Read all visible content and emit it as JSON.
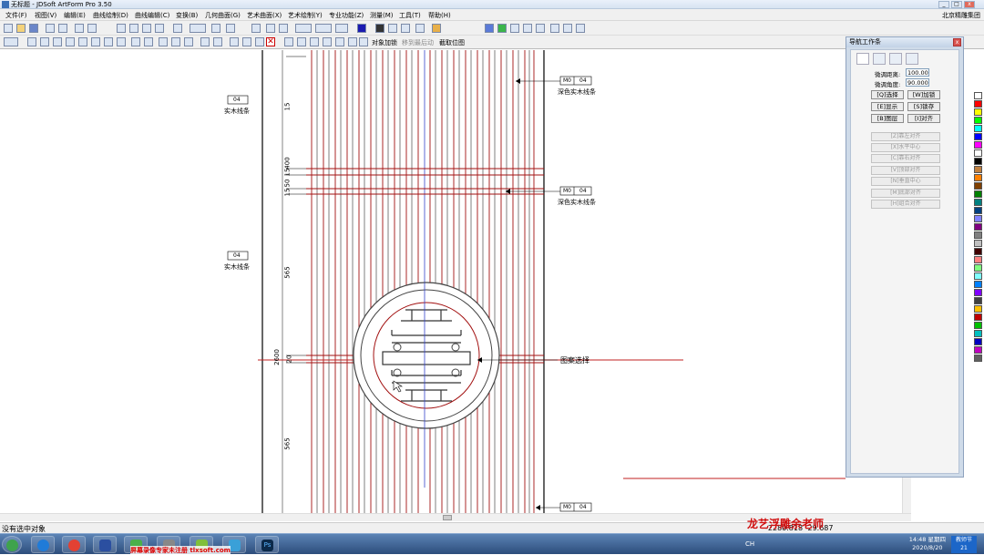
{
  "window": {
    "title": "无标题 - JDSoft ArtForm Pro 3.50",
    "company": "北京精雕集团"
  },
  "menu": [
    "文件(F)",
    "视图(V)",
    "编辑(E)",
    "曲线绘制(D)",
    "曲线编辑(C)",
    "变换(B)",
    "几何曲面(G)",
    "艺术曲面(X)",
    "艺术绘制(Y)",
    "专业功能(Z)",
    "测量(M)",
    "工具(T)",
    "帮助(H)"
  ],
  "toolbar2": {
    "object_add": "对象加锁",
    "move_follow": "移到最后动",
    "capture_bitmap": "截取位图"
  },
  "drawing": {
    "dims_left": [
      "15",
      "400",
      "15",
      "50",
      "15",
      "565",
      "2600",
      "20",
      "565"
    ],
    "left_tags": [
      {
        "code": "04",
        "label": "实木线条"
      },
      {
        "code": "04",
        "label": "实木线条"
      }
    ],
    "right_tags": [
      {
        "code_a": "M0",
        "code_b": "04",
        "label": "深色实木线条"
      },
      {
        "code_a": "M0",
        "code_b": "04",
        "label": "深色实木线条"
      },
      {
        "code_a": "M0",
        "code_b": "04",
        "label": ""
      }
    ],
    "pattern_label": "图案选择"
  },
  "panel": {
    "title": "导航工作条",
    "fine_distance_label": "微调距离:",
    "fine_distance_value": "100.00",
    "fine_angle_label": "微调角度:",
    "fine_angle_value": "90.000",
    "buttons": [
      "[Q]选择",
      "[W]加锁",
      "[E]显示",
      "[S]锁存",
      "[B]图层",
      "[I]对齐"
    ],
    "disabled_buttons": [
      "[Z]靠左对齐",
      "[X]水平中心",
      "[C]靠右对齐",
      "[V]顶部对齐",
      "[N]垂直中心",
      "[M]底部对齐",
      "[H]组合对齐"
    ]
  },
  "palette": [
    "#ffffff",
    "#ff0000",
    "#ffff00",
    "#00ff00",
    "#00ffff",
    "#0000ff",
    "#ff00ff",
    "#ffffff",
    "#000000",
    "#c08040",
    "#ff8000",
    "#804000",
    "#008000",
    "#008080",
    "#004080",
    "#8080ff",
    "#800080",
    "#808080",
    "#c0c0c0",
    "#400000",
    "#ff8080",
    "#80ff80",
    "#80ffff",
    "#0080ff",
    "#8000ff",
    "#404040",
    "#ffc000",
    "#c00000",
    "#00c000",
    "#00c0c0",
    "#0000c0",
    "#c000c0",
    "#606060"
  ],
  "status": {
    "message": "没有选中对象",
    "coords": "-2280.818  -29.687"
  },
  "overlay": {
    "teacher": "龙艺浮雕余老师",
    "watermark": "屏幕录像专家未注册 tlxsoft.com"
  },
  "taskbar": {
    "clock_time": "14:48 星期四",
    "clock_date": "2020/8/20",
    "desktop_label": "教师节",
    "desktop_day": "21",
    "lang": "CH"
  }
}
